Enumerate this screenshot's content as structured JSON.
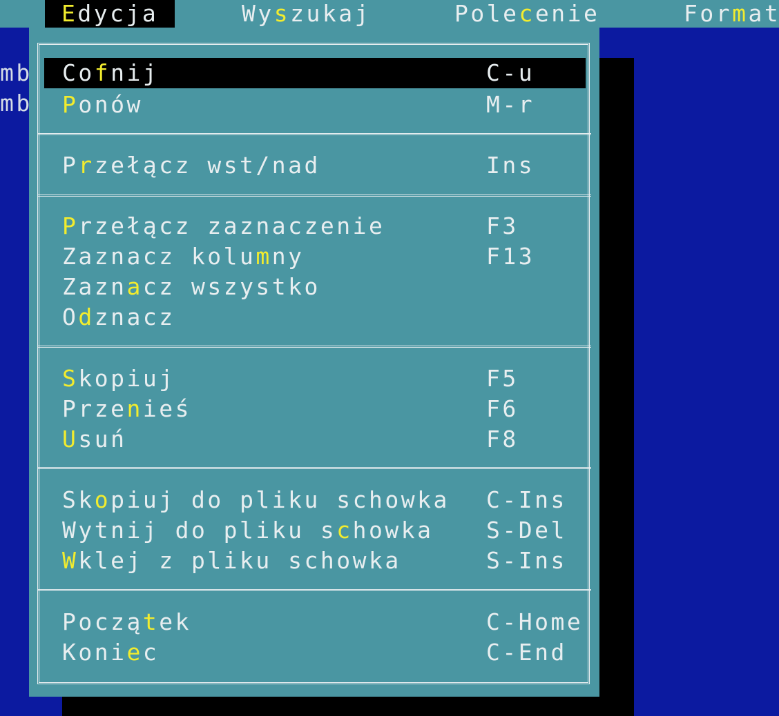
{
  "menubar": {
    "items": [
      {
        "pre": "",
        "key": "E",
        "post": "dycja",
        "active": true
      },
      {
        "pre": "Wy",
        "key": "s",
        "post": "zukaj",
        "active": false
      },
      {
        "pre": "Pole",
        "key": "c",
        "post": "enie",
        "active": false
      },
      {
        "pre": "For",
        "key": "m",
        "post": "at",
        "active": false
      }
    ]
  },
  "background": {
    "edge_lines": [
      "mb",
      "mb"
    ]
  },
  "edit_menu": {
    "items": [
      {
        "pre": "Co",
        "key": "f",
        "post": "nij",
        "shortcut": "C-u",
        "selected": true
      },
      {
        "pre": "",
        "key": "P",
        "post": "onów",
        "shortcut": "M-r",
        "selected": false
      },
      {
        "pre": "P",
        "key": "r",
        "post": "zełącz wst/nad",
        "shortcut": "Ins",
        "selected": false
      },
      {
        "pre": "",
        "key": "P",
        "post": "rzełącz zaznaczenie",
        "shortcut": "F3",
        "selected": false
      },
      {
        "pre": "Zaznacz kolu",
        "key": "m",
        "post": "ny",
        "shortcut": "F13",
        "selected": false
      },
      {
        "pre": "Zazn",
        "key": "a",
        "post": "cz wszystko",
        "shortcut": "",
        "selected": false
      },
      {
        "pre": "O",
        "key": "d",
        "post": "znacz",
        "shortcut": "",
        "selected": false
      },
      {
        "pre": "",
        "key": "S",
        "post": "kopiuj",
        "shortcut": "F5",
        "selected": false
      },
      {
        "pre": "Prze",
        "key": "n",
        "post": "ieś",
        "shortcut": "F6",
        "selected": false
      },
      {
        "pre": "",
        "key": "U",
        "post": "suń",
        "shortcut": "F8",
        "selected": false
      },
      {
        "pre": "Sk",
        "key": "o",
        "post": "piuj do pliku schowka",
        "shortcut": "C-Ins",
        "selected": false
      },
      {
        "pre": "Wytnij do pliku s",
        "key": "c",
        "post": "howka",
        "shortcut": "S-Del",
        "selected": false
      },
      {
        "pre": "",
        "key": "W",
        "post": "klej z pliku schowka",
        "shortcut": "S-Ins",
        "selected": false
      },
      {
        "pre": "Począ",
        "key": "t",
        "post": "ek",
        "shortcut": "C-Home",
        "selected": false
      },
      {
        "pre": "Koni",
        "key": "e",
        "post": "c",
        "shortcut": "C-End",
        "selected": false
      }
    ]
  },
  "colors": {
    "desktop": "#0c1aa0",
    "menu_bg": "#4a96a2",
    "menu_text": "#e8eef0",
    "hotkey": "#f2ec2e",
    "selection": "#000000"
  }
}
